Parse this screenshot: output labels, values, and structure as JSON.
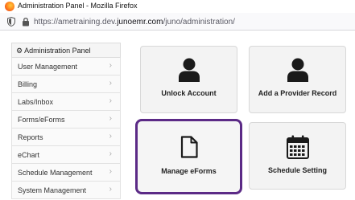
{
  "browser": {
    "title": "Administration Panel - Mozilla Firefox",
    "url_prefix": "https://ametraining.dev.",
    "url_host": "junoemr.com",
    "url_path": "/juno/administration/"
  },
  "sidebar": {
    "header": "Administration Panel",
    "items": [
      {
        "label": "User Management"
      },
      {
        "label": "Billing"
      },
      {
        "label": "Labs/Inbox"
      },
      {
        "label": "Forms/eForms"
      },
      {
        "label": "Reports"
      },
      {
        "label": "eChart"
      },
      {
        "label": "Schedule Management"
      },
      {
        "label": "System Management"
      }
    ]
  },
  "tiles": {
    "unlock_account": {
      "label": "Unlock Account",
      "icon": "user-icon"
    },
    "add_provider": {
      "label": "Add a Provider Record",
      "icon": "user-icon"
    },
    "manage_eforms": {
      "label": "Manage eForms",
      "icon": "document-icon"
    },
    "schedule_setting": {
      "label": "Schedule Setting",
      "icon": "calendar-icon"
    }
  },
  "colors": {
    "active_outline": "#5b2a86",
    "icon": "#1a1a1a"
  }
}
